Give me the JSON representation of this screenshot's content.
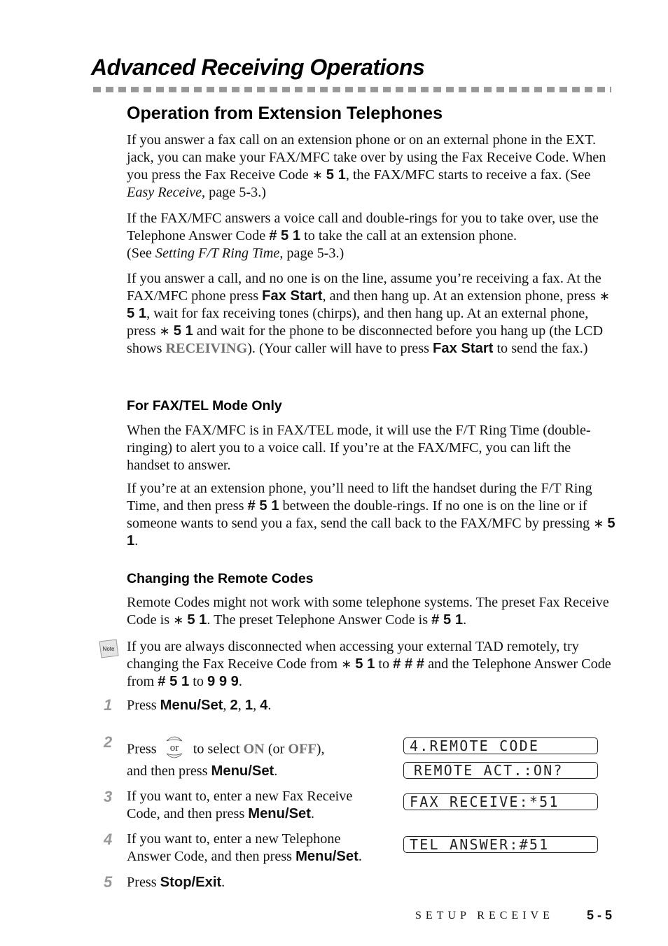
{
  "chapter_title": "Advanced Receiving Operations",
  "section": {
    "title": "Operation from Extension Telephones",
    "paragraphs": {
      "p1": {
        "a": "If you answer a fax call on an extension phone or on an external phone in the EXT. jack, you can make your FAX/MFC take over by using the Fax Receive Code. When you press the Fax Receive Code ",
        "star": "∗",
        "code": "5 1",
        "b": ", the FAX/MFC starts to receive a fax. (See ",
        "ref": "Easy Receive",
        "c": ", page 5-3.)"
      },
      "p2": {
        "a": "If the FAX/MFC answers a voice call and double-rings for you to take over, use the Telephone Answer Code ",
        "code": "# 5 1",
        "b": " to take the call at an extension phone.",
        "c": "(See ",
        "ref": "Setting F/T Ring Time",
        "d": ", page 5-3.)"
      },
      "p3": {
        "a": "If you answer a call, and no one is on the line, assume you’re receiving a fax. At the FAX/MFC phone press ",
        "key1": "Fax Start",
        "b": ", and then hang up. At an extension phone, press ",
        "star": "∗",
        "code": "5 1",
        "c": ", wait for fax receiving tones (chirps), and then hang up.  At an external phone, press ",
        "d": " and wait for the phone to be disconnected before you hang up (the LCD shows ",
        "lcd_word": "RECEIVING",
        "e": "). (Your caller will have to press ",
        "key2": "Fax Start",
        "f": " to send the fax.)"
      }
    }
  },
  "subsection_fax_tel": {
    "title": "For FAX/TEL Mode Only",
    "p1": "When the FAX/MFC is in FAX/TEL mode, it will use the F/T Ring Time (double-ringing) to alert you to a voice call. If you’re at the FAX/MFC, you can lift the handset to answer.",
    "p2": {
      "a": "If you’re at an extension phone, you’ll need to lift the handset during the F/T Ring Time, and then press ",
      "code1": "# 5 1",
      "b": " between the double-rings. If no one is on the line or if someone wants to send you a fax, send the call back to the FAX/MFC by pressing ",
      "star": "∗",
      "code2": "5 1",
      "c": "."
    }
  },
  "subsection_remote": {
    "title": "Changing the Remote Codes",
    "p1": {
      "a": "Remote Codes might not work with some telephone systems. The preset Fax Receive Code is ",
      "star": "∗",
      "code1": "5 1",
      "b": ". The preset Telephone Answer Code is ",
      "code2": "# 5 1",
      "c": "."
    },
    "note": {
      "icon_label": "Note",
      "a": "If you are always disconnected when accessing your external TAD remotely, try changing the Fax Receive Code from ",
      "star": "∗",
      "code1": "5 1",
      "b": " to ",
      "code2": "# # #",
      "c": " and the Telephone Answer Code from ",
      "code3": "# 5 1",
      "d": " to ",
      "code4": "9 9 9",
      "e": "."
    },
    "steps": [
      {
        "num": "1",
        "a": "Press ",
        "k1": "Menu/Set",
        "s1": ", ",
        "k2": "2",
        "s2": ", ",
        "k3": "1",
        "s3": ", ",
        "k4": "4",
        "s4": "."
      },
      {
        "num": "2",
        "a": "Press ",
        "nav_or": "or",
        "b": " to select ",
        "on": "ON",
        "c": " (or ",
        "off": "OFF",
        "d": "),",
        "e": "and then press ",
        "key": "Menu/Set",
        "f": "."
      },
      {
        "num": "3",
        "a": "If you want to, enter a new Fax Receive Code, and then press ",
        "key": "Menu/Set",
        "b": "."
      },
      {
        "num": "4",
        "a": "If you want to, enter a new Telephone Answer Code, and then press ",
        "key": "Menu/Set",
        "b": "."
      },
      {
        "num": "5",
        "a": "Press ",
        "key": "Stop/Exit",
        "b": "."
      }
    ],
    "lcd_screens": [
      "4.REMOTE CODE",
      "REMOTE ACT.:ON?",
      "FAX RECEIVE:*51",
      "TEL ANSWER:#51"
    ]
  },
  "footer": {
    "section_label": "SETUP RECEIVE",
    "page_number": "5 - 5"
  }
}
